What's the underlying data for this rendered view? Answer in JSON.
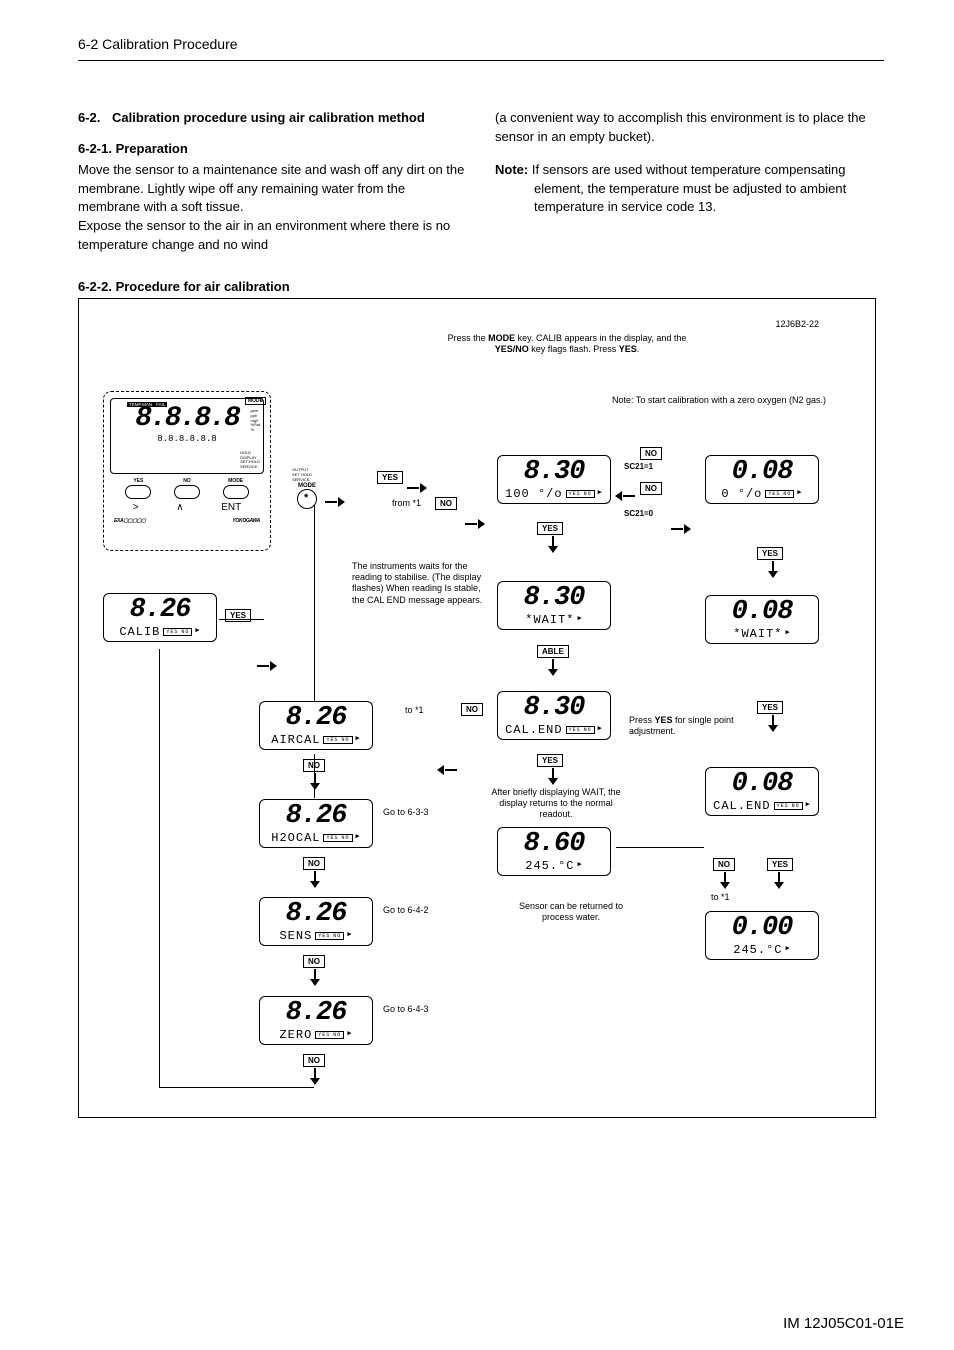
{
  "header": "6-2 Calibration Procedure",
  "footer_code": "IM 12J05C01-01E",
  "section": {
    "number": "6-2.",
    "title": "Calibration procedure using air calibration method",
    "sub1_head": "6-2-1. Preparation",
    "sub1_body_a": "Move the sensor to a maintenance site and wash off any dirt on the membrane. Lightly wipe off any remaining water from the membrane with a soft tissue.",
    "sub1_body_b": "Expose the sensor to the air in an environment where there is no temperature change and no wind",
    "col2_para": "(a convenient way to accomplish this environment is to place the sensor in an empty bucket).",
    "note_label": "Note:",
    "note_body": "If sensors are used without temperature compensating element, the temperature must be adjusted to ambient temperature in service code 13.",
    "sub2_head": "6-2-2. Procedure for air calibration"
  },
  "diagram": {
    "figure_code": "12J6B2-22",
    "intro_l1": "Press the ",
    "intro_mode": "MODE",
    "intro_l1b": " key.  CALIB  appears in the display, and the",
    "intro_l2a": "YES/NO",
    "intro_l2b": " key  flags flash. Press ",
    "intro_yes": "YES",
    "intro_l2c": ".",
    "zero_note": "Note: To start calibration with a zero oxygen (N2 gas.)",
    "from_star1": "from *1",
    "stab_text": "The instruments waits for the reading to stabilise. (The display flashes) When reading Is stable, the CAL END message appears.",
    "to_star1": "to *1",
    "after_wait": "After briefly displaying WAIT, the display returns to the normal readout.",
    "sensor_return": "Sensor can be returned to process water.",
    "press_yes_single": "Press YES for single point adjustment.",
    "press_yes_single_b": "YES",
    "goto_633": "Go to 6-3-3",
    "goto_642": "Go to 6-4-2",
    "goto_643": "Go to 6-4-3",
    "keys": {
      "YES": "YES",
      "NO": "NO",
      "ABLE": "ABLE",
      "SC21_1": "SC21=1",
      "SC21_0": "SC21=0"
    },
    "device": {
      "topbar": [
        "TEMP.MAN",
        "FAIL"
      ],
      "mode_tag": "MODE",
      "num": "8.8.8.8",
      "bar": "8.8.8.8.8.8",
      "side1": [
        "ppm",
        "ppb",
        "mg/l",
        "%Sat",
        "%"
      ],
      "side2": [
        "HOLD",
        "DISPLAY",
        "SET HOLD",
        "SERVICE"
      ],
      "side2b": [
        "OUTPUT",
        "SET HOLD",
        "SERVICE"
      ],
      "btns": [
        "YES",
        "NO",
        "MODE"
      ],
      "btns2": [
        ">",
        "∧",
        "ENT"
      ],
      "brand_l": "EXA▢▢▢▢▢",
      "brand_r": "YOKOGAWA"
    },
    "lcds": {
      "calib": {
        "num": "8.26",
        "sub": "CALIB"
      },
      "aircal": {
        "num": "8.26",
        "sub": "AIRCAL"
      },
      "h2ocal": {
        "num": "8.26",
        "sub": "H2OCAL"
      },
      "sens": {
        "num": "8.26",
        "sub": "SENS"
      },
      "zero": {
        "num": "8.26",
        "sub": "ZERO"
      },
      "mid_830_100": {
        "num": "8.30",
        "sub": "100 °/o"
      },
      "mid_830_wait": {
        "num": "8.30",
        "sub": "*WAIT*"
      },
      "mid_830_calend": {
        "num": "8.30",
        "sub": "CAL.END"
      },
      "mid_860_245": {
        "num": "8.60",
        "sub": "245.°C"
      },
      "r_008_0": {
        "num": "0.08",
        "sub": "0 °/o"
      },
      "r_008_wait": {
        "num": "0.08",
        "sub": "*WAIT*"
      },
      "r_008_calend": {
        "num": "0.08",
        "sub": "CAL.END"
      },
      "r_000_245": {
        "num": "0.00",
        "sub": "245.°C"
      }
    }
  }
}
